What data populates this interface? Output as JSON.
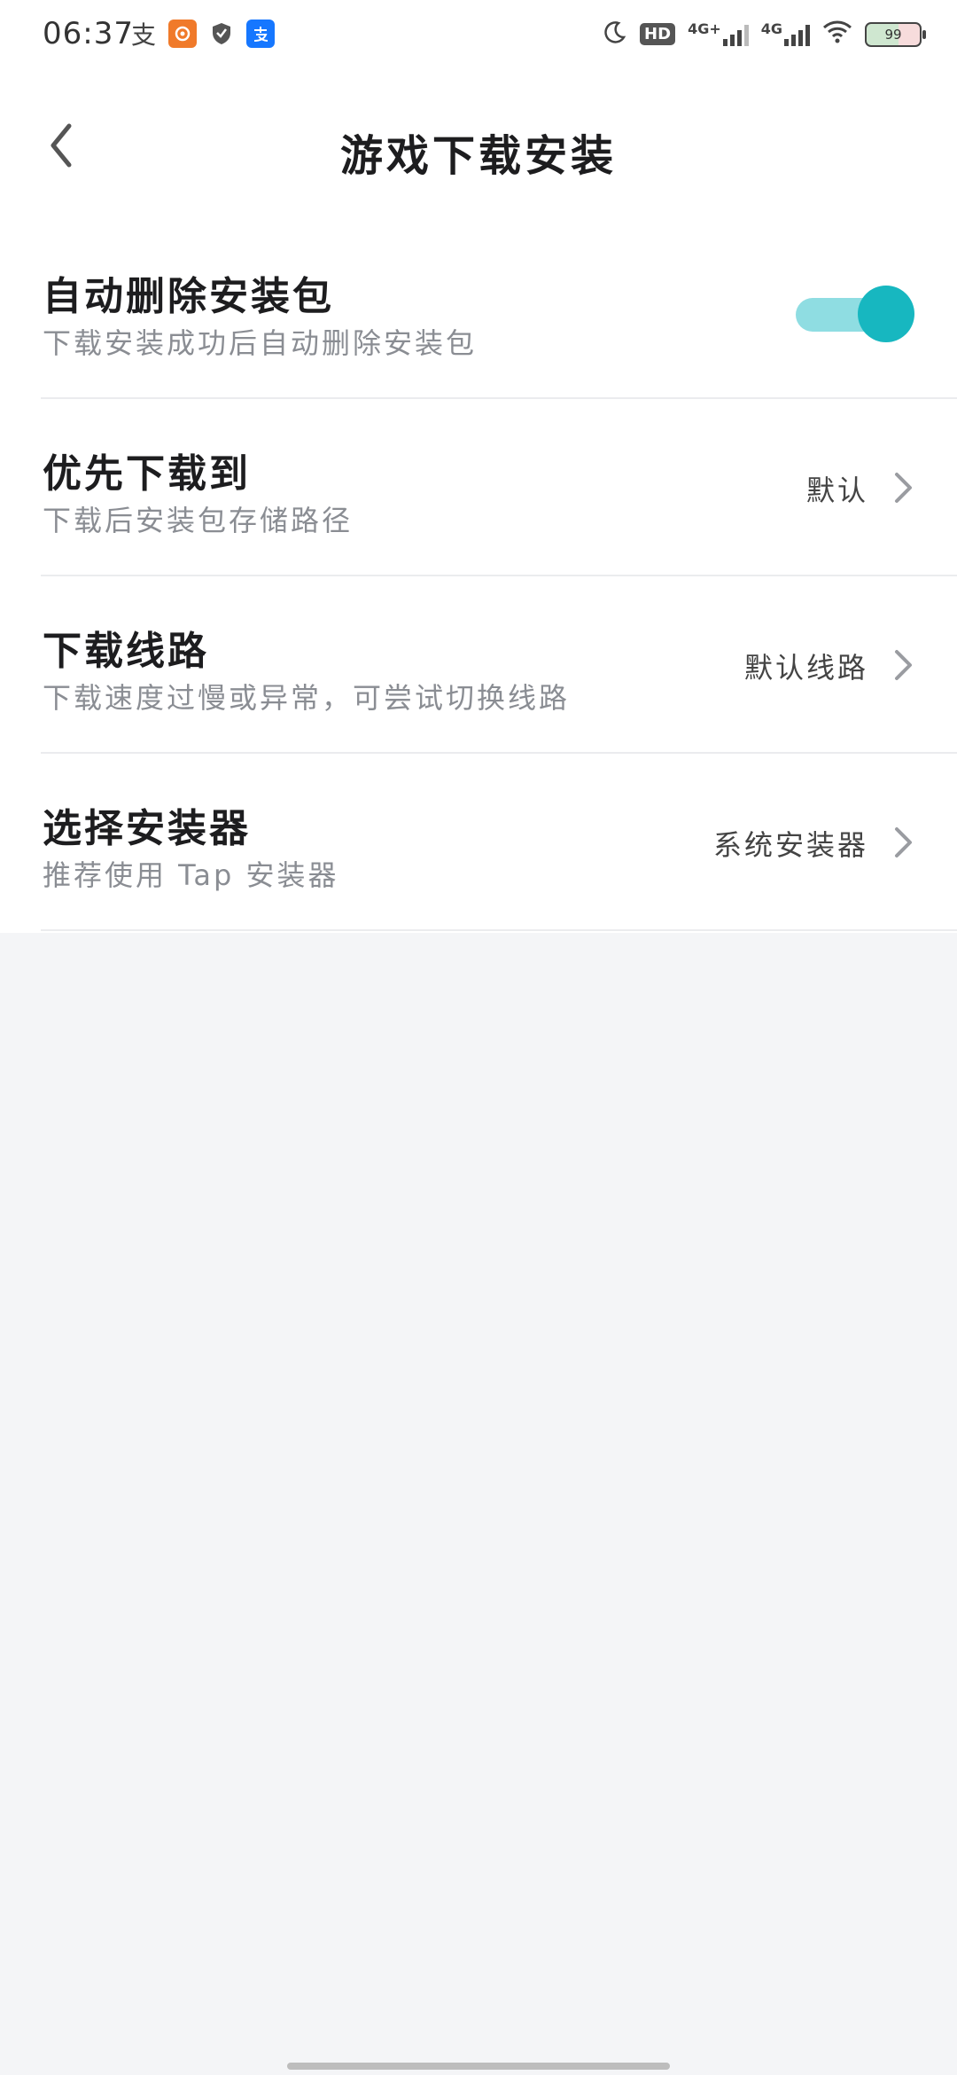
{
  "status_bar": {
    "time": "06:37",
    "left_icon_1_glyph": "支",
    "hd_label": "HD",
    "network_1": "4G+",
    "network_2": "4G",
    "battery": "99"
  },
  "header": {
    "title": "游戏下载安装"
  },
  "settings": {
    "auto_delete": {
      "title": "自动删除安装包",
      "subtitle": "下载安装成功后自动删除安装包",
      "enabled": true
    },
    "download_location": {
      "title": "优先下载到",
      "subtitle": "下载后安装包存储路径",
      "value": "默认"
    },
    "download_route": {
      "title": "下载线路",
      "subtitle": "下载速度过慢或异常，可尝试切换线路",
      "value": "默认线路"
    },
    "installer": {
      "title": "选择安装器",
      "subtitle": "推荐使用 Tap 安装器",
      "value": "系统安装器"
    }
  },
  "colors": {
    "accent": "#17b7c0",
    "accent_track": "#8fdde2",
    "page_bg": "#f4f5f7",
    "card_bg": "#ffffff"
  },
  "icons": {
    "back": "chevron-left-icon",
    "row_arrow": "chevron-right-icon"
  }
}
